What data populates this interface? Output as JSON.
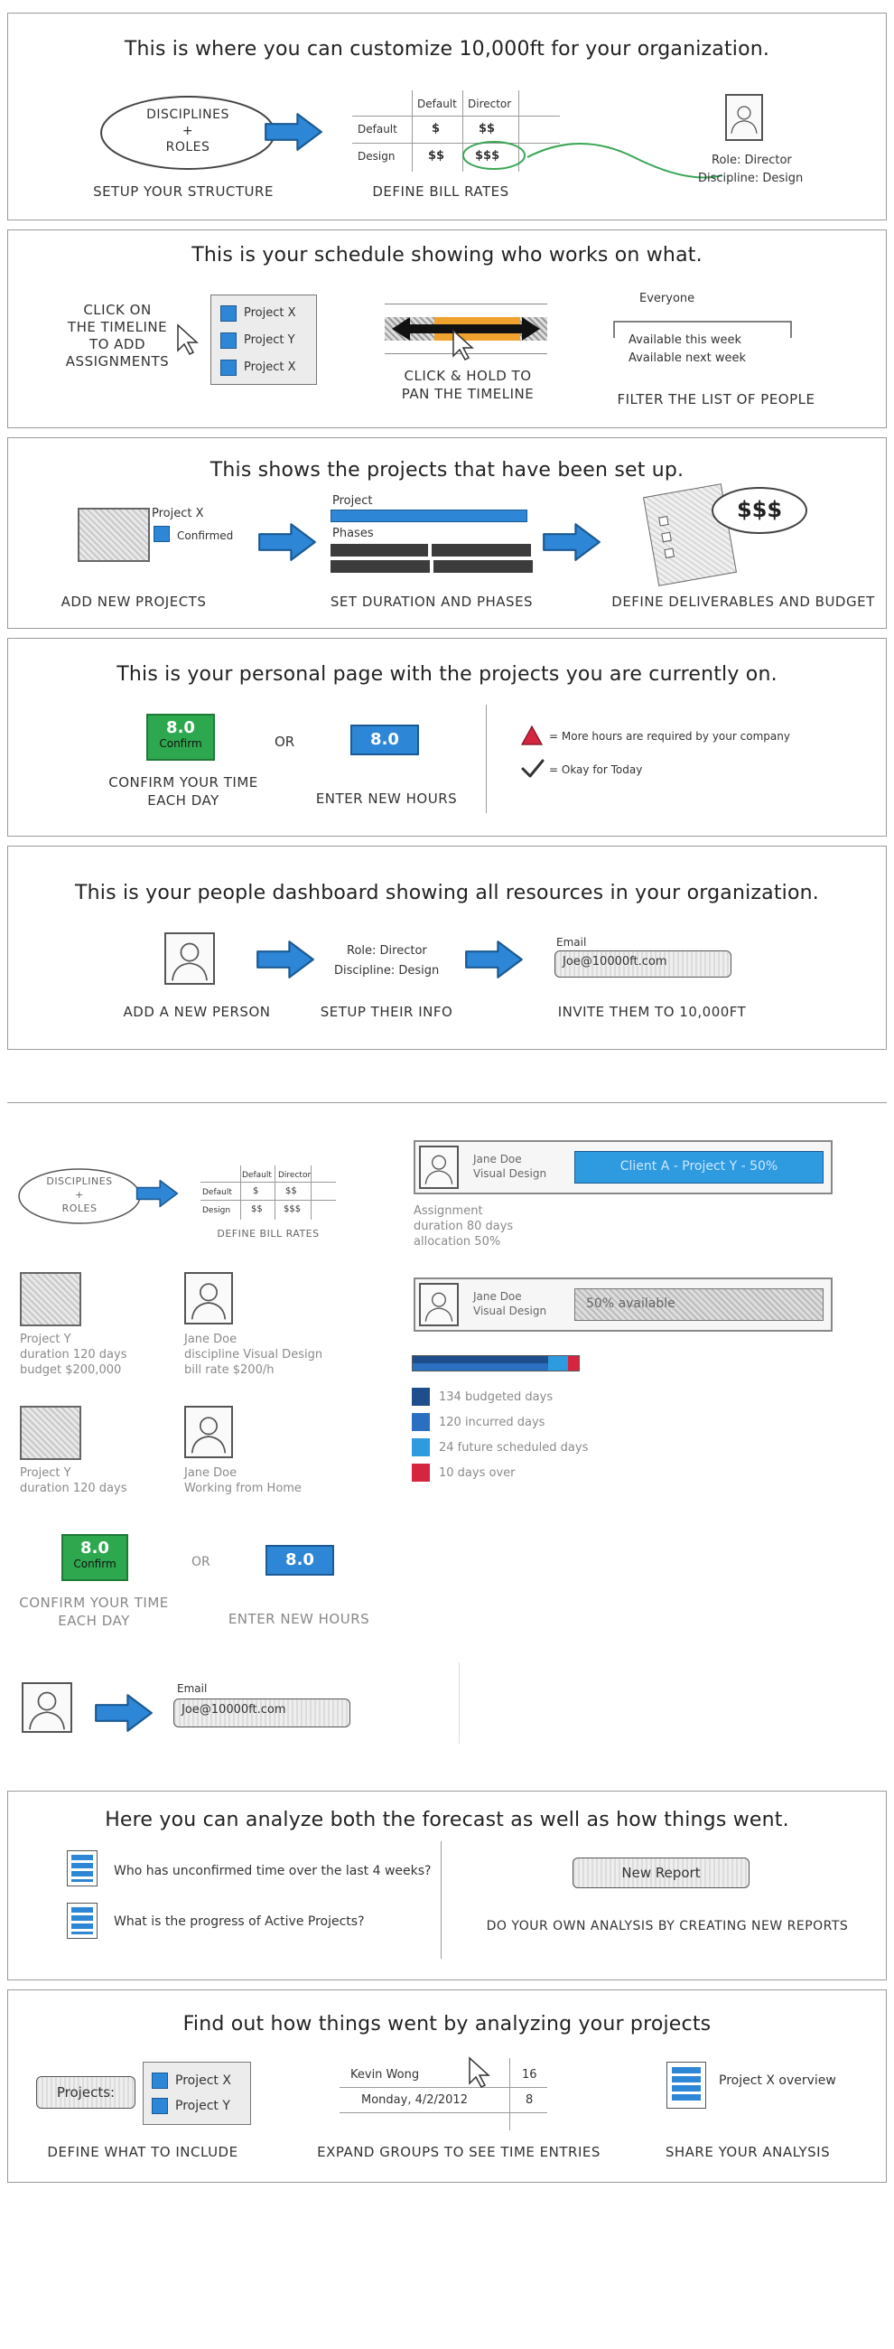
{
  "sections": {
    "structure": {
      "title": "This is where you can customize 10,000ft for your organization.",
      "ellipse_text": "DISCIPLINES\n+\nROLES",
      "rate_table": {
        "col_default": "Default",
        "col_director": "Director",
        "row_default": "Default",
        "row_design": "Design",
        "r1c1": "$",
        "r1c2": "$$",
        "r2c1": "$$",
        "r2c2": "$$$"
      },
      "role": "Role: Director",
      "discipline": "Discipline: Design",
      "cap_structure": "SETUP YOUR STRUCTURE",
      "cap_rates": "DEFINE BILL RATES"
    },
    "schedule": {
      "title": "This is your schedule showing who works on what.",
      "click_text": "CLICK ON\nTHE TIMELINE\nTO ADD\nASSIGNMENTS",
      "projects": [
        "Project X",
        "Project Y",
        "Project X"
      ],
      "pan_caption": "CLICK & HOLD TO\nPAN THE TIMELINE",
      "filter_header": "Everyone",
      "filter_items": [
        "Available this week",
        "Available next week"
      ],
      "filter_caption": "FILTER THE LIST OF PEOPLE"
    },
    "projects": {
      "title": "This shows the projects that have been set up.",
      "project_name": "Project X",
      "confirmed": "Confirmed",
      "bar_project": "Project",
      "bar_phases": "Phases",
      "money": "$$$",
      "cap_add": "ADD NEW PROJECTS",
      "cap_duration": "SET DURATION AND PHASES",
      "cap_deliverables": "DEFINE DELIVERABLES AND BUDGET"
    },
    "personal": {
      "title": "This is your personal page with the projects you are currently on.",
      "hours_value": "8.0",
      "confirm_label": "Confirm",
      "or": "OR",
      "cap_confirm": "CONFIRM YOUR TIME\nEACH DAY",
      "cap_enter": "ENTER NEW HOURS",
      "legend_more": "= More hours are required by your company",
      "legend_okay": "= Okay for Today"
    },
    "people": {
      "title": "This is your people dashboard showing all resources in your organization.",
      "role": "Role: Director",
      "discipline": "Discipline: Design",
      "email_label": "Email",
      "email_value": "Joe@10000ft.com",
      "cap_add": "ADD A NEW PERSON",
      "cap_setup": "SETUP THEIR INFO",
      "cap_invite": "INVITE THEM TO 10,000FT"
    },
    "assets": {
      "ellipse_text": "DISCIPLINES\n+\nROLES",
      "rate_table": {
        "col_default": "Default",
        "col_director": "Director",
        "row_default": "Default",
        "row_design": "Design",
        "r1c1": "$",
        "r1c2": "$$",
        "r2c1": "$$",
        "r2c2": "$$$"
      },
      "cap_rates": "DEFINE BILL RATES",
      "card1": {
        "name": "Jane Doe",
        "discipline": "Visual Design",
        "assignment": "Client A - Project Y - 50%",
        "details": "Assignment\nduration 80 days\nallocation 50%"
      },
      "card2": {
        "name": "Jane Doe",
        "discipline": "Visual Design",
        "available": "50% available"
      },
      "project_y_1": "Project Y\nduration 120 days\nbudget $200,000",
      "jane_1": "Jane Doe\ndiscipline Visual Design\nbill rate $200/h",
      "project_y_2": "Project Y\nduration 120 days",
      "jane_2": "Jane Doe\nWorking from Home",
      "legend": [
        {
          "label": "134 budgeted days",
          "color": "#1f4e8c"
        },
        {
          "label": "120 incurred days",
          "color": "#2a6fc0"
        },
        {
          "label": "24 future scheduled days",
          "color": "#2e9ae0"
        },
        {
          "label": "10 days over",
          "color": "#d6263f"
        }
      ],
      "hours_value": "8.0",
      "confirm_label": "Confirm",
      "or": "OR",
      "cap_confirm": "CONFIRM YOUR TIME\nEACH DAY",
      "cap_enter": "ENTER NEW HOURS",
      "email_label": "Email",
      "email_value": "Joe@10000ft.com"
    },
    "analyze": {
      "title": "Here you can analyze both the forecast as well as how things went.",
      "q1": "Who has unconfirmed time over the last 4 weeks?",
      "q2": "What is the progress of Active Projects?",
      "new_report": "New Report",
      "cap_new": "DO YOUR OWN ANALYSIS BY CREATING NEW REPORTS"
    },
    "analyze_projects": {
      "title": "Find out how things went by analyzing your projects",
      "projects_label": "Projects:",
      "projects": [
        "Project X",
        "Project Y"
      ],
      "person": "Kevin Wong",
      "date": "Monday, 4/2/2012",
      "val1": "16",
      "val2": "8",
      "overview": "Project X overview",
      "cap_include": "DEFINE WHAT TO INCLUDE",
      "cap_expand": "EXPAND GROUPS TO SEE TIME ENTRIES",
      "cap_share": "SHARE YOUR ANALYSIS"
    }
  },
  "colors": {
    "blue": "#2e86d6",
    "green": "#2ea84f",
    "orange": "#f0a22e",
    "red": "#d6263f"
  }
}
